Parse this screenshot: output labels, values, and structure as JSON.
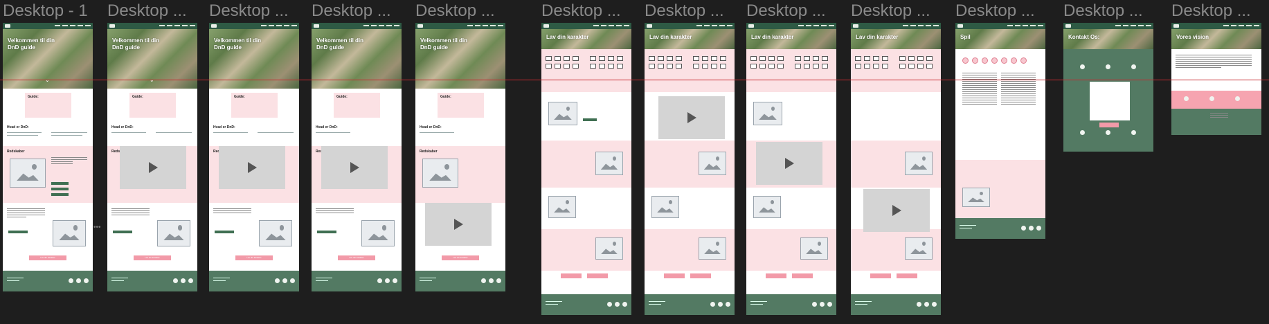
{
  "canvas": {
    "background": "#1e1e1e",
    "guide_color": "#c7292f"
  },
  "colors": {
    "green": "#537a63",
    "pink": "#fbe1e4",
    "pink_button": "#f29aa8",
    "nav": "#2e5a44"
  },
  "frames": [
    {
      "title": "Desktop - 1"
    },
    {
      "title": "Desktop ..."
    },
    {
      "title": "Desktop ..."
    },
    {
      "title": "Desktop ..."
    },
    {
      "title": "Desktop ..."
    },
    {
      "title": "Desktop ..."
    },
    {
      "title": "Desktop ..."
    },
    {
      "title": "Desktop ..."
    },
    {
      "title": "Desktop ..."
    },
    {
      "title": "Desktop ..."
    },
    {
      "title": "Desktop ..."
    },
    {
      "title": "Desktop ..."
    }
  ],
  "home": {
    "hero_title": "Velkommen til din DnD guide",
    "guide_title": "Guide:",
    "what_is_title": "Hvad er DnD:",
    "tools_title": "Redskaber",
    "cta_label": "Lav din karakter"
  },
  "character": {
    "hero_title": "Lav din karakter"
  },
  "game": {
    "hero_title": "Spil"
  },
  "contact": {
    "hero_title": "Kontakt Os:"
  },
  "vision": {
    "hero_title": "Vores vision"
  },
  "icons": [
    "discord-icon",
    "facebook-icon",
    "instagram-icon",
    "play-icon",
    "image-placeholder-icon",
    "chevron-down-icon"
  ]
}
